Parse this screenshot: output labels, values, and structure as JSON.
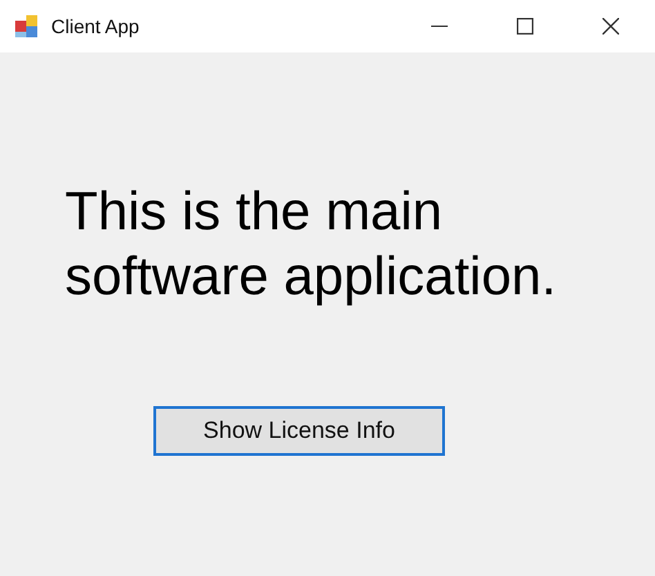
{
  "window": {
    "title": "Client App"
  },
  "message": "This is the main software application.",
  "button": {
    "label": "Show License Info",
    "focused": true
  }
}
